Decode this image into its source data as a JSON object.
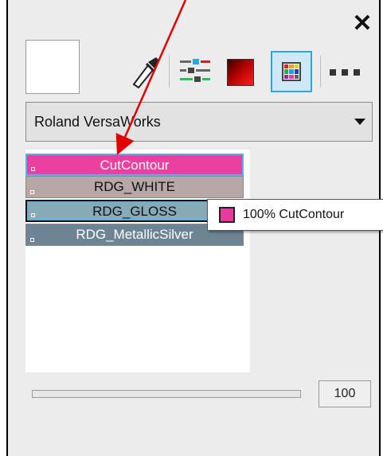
{
  "window": {
    "close_glyph": "✕"
  },
  "toolbar": {
    "icons": [
      "eyedropper-icon",
      "color-mixer-icon",
      "gradient-icon",
      "color-palette-icon",
      "more-icon"
    ],
    "accent": "#29a8e0"
  },
  "palette_dropdown": {
    "selected": "Roland VersaWorks"
  },
  "swatches": [
    {
      "name": "CutContour",
      "color": "#ec3fa0"
    },
    {
      "name": "RDG_WHITE",
      "color": "#b7a7a7"
    },
    {
      "name": "RDG_GLOSS",
      "color": "#88a9b8"
    },
    {
      "name": "RDG_MetallicSilver",
      "color": "#6c8494"
    }
  ],
  "tooltip": {
    "text": "100% CutContour",
    "color": "#e83a9c"
  },
  "tint": {
    "value": "100"
  },
  "annotation": {
    "color": "#e00000"
  }
}
